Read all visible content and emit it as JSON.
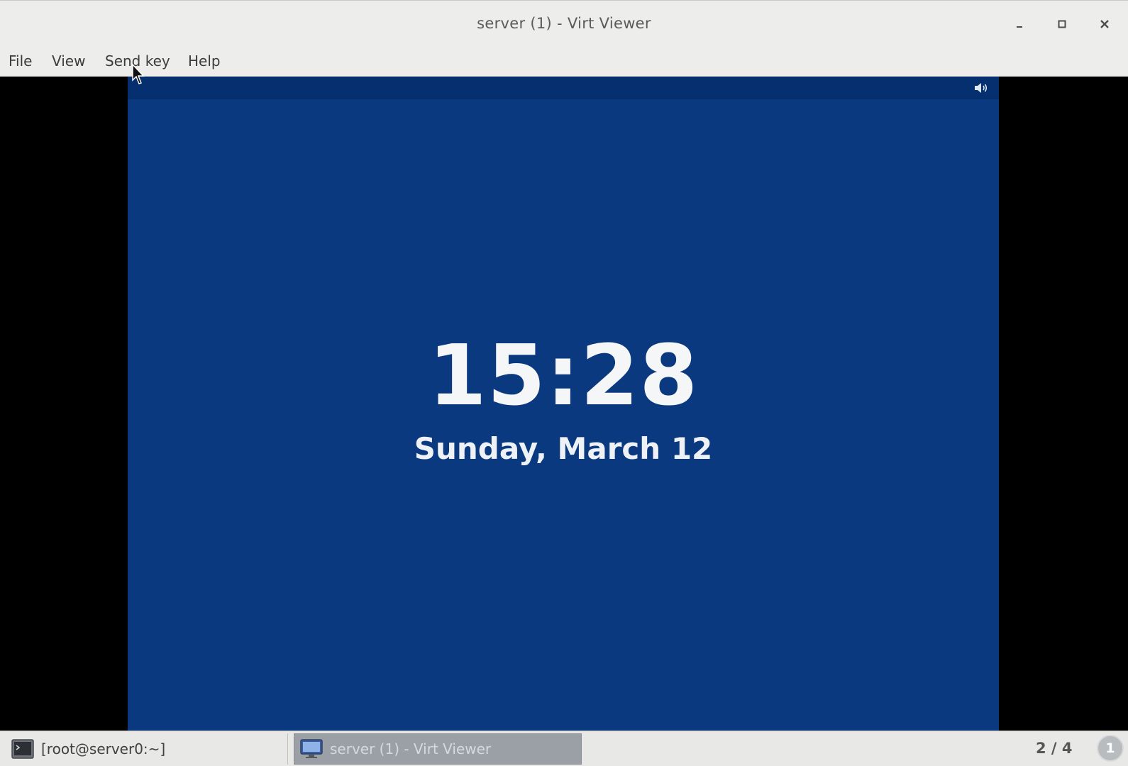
{
  "window": {
    "title": "server (1) - Virt Viewer",
    "controls": {
      "minimize": "minimize-icon",
      "maximize": "maximize-icon",
      "close": "close-icon"
    }
  },
  "menubar": {
    "items": [
      "File",
      "View",
      "Send key",
      "Help"
    ]
  },
  "guest": {
    "background_color": "#0a3980",
    "topbar_icon": "volume-icon",
    "clock_time": "15:28",
    "clock_date": "Sunday, March 12"
  },
  "taskbar": {
    "tasks": [
      {
        "label": "[root@server0:~]",
        "icon": "terminal-icon",
        "active": false
      },
      {
        "label": "server (1) - Virt Viewer",
        "icon": "virt-viewer-icon",
        "active": true
      }
    ],
    "workspace": "2 / 4",
    "notification_count": "1"
  }
}
